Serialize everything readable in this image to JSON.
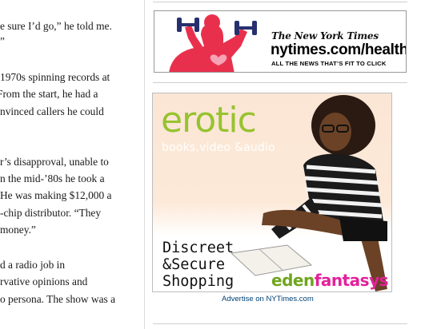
{
  "article": {
    "lines": [
      "e sure I’d go,” he told me.",
      "”",
      "1970s spinning records at",
      " From the start, he had a",
      "nvinced callers he could",
      "r’s disapproval, unable to",
      "n the mid-’80s he took a",
      "He was making $12,000 a",
      "-chip distributor. “They",
      "money.”",
      "d a radio job in",
      "rvative opinions and",
      "o persona. The show was a"
    ]
  },
  "banner": {
    "masthead": "The New York Times",
    "url": "nytimes.com/health",
    "tagline": "ALL THE NEWS THAT’S FIT TO CLICK",
    "colors": {
      "figure": "#e8304d",
      "weights": "#27306e",
      "heart": "#f6a3b5"
    }
  },
  "ad": {
    "headline": "erotic",
    "subhead": "books,video &audio",
    "pitch": "Discreet\n&Secure\nShopping",
    "brand_part1": "eden",
    "brand_part2": "fantasys",
    "colors": {
      "headline": "#97c32f",
      "eden": "#6fa51e",
      "fantasys": "#e3219b",
      "background": "#fbe6d5"
    }
  },
  "advertise_link": "Advertise on NYTimes.com"
}
